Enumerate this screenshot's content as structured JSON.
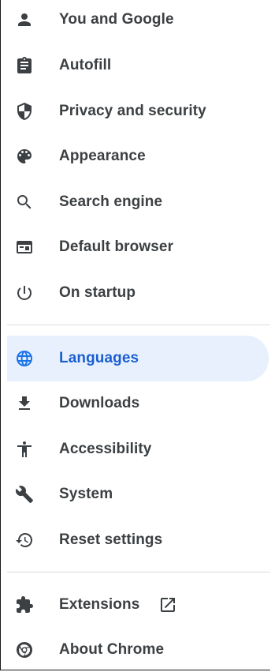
{
  "settings_menu": {
    "items": [
      {
        "label": "You and Google",
        "icon": "person-icon"
      },
      {
        "label": "Autofill",
        "icon": "clipboard-icon"
      },
      {
        "label": "Privacy and security",
        "icon": "shield-icon"
      },
      {
        "label": "Appearance",
        "icon": "palette-icon"
      },
      {
        "label": "Search engine",
        "icon": "search-icon"
      },
      {
        "label": "Default browser",
        "icon": "browser-window-icon"
      },
      {
        "label": "On startup",
        "icon": "power-icon"
      },
      {
        "label": "Languages",
        "icon": "globe-icon",
        "selected": true
      },
      {
        "label": "Downloads",
        "icon": "download-icon"
      },
      {
        "label": "Accessibility",
        "icon": "accessibility-icon"
      },
      {
        "label": "System",
        "icon": "wrench-icon"
      },
      {
        "label": "Reset settings",
        "icon": "restore-icon"
      },
      {
        "label": "Extensions",
        "icon": "puzzle-icon",
        "external": true
      },
      {
        "label": "About Chrome",
        "icon": "chrome-icon"
      }
    ]
  },
  "colors": {
    "selected_background": "#e8f0fe",
    "selected_text": "#1a5fd0",
    "selected_icon": "#1a73e8",
    "default_text": "#3c4043",
    "divider": "#dadce0"
  }
}
